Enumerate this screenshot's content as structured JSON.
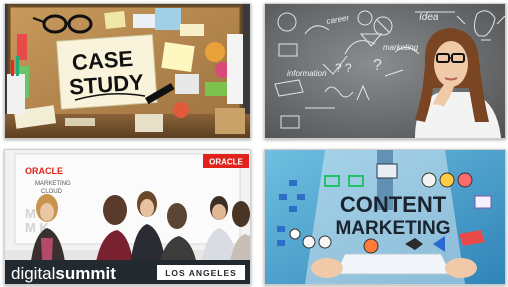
{
  "tiles": [
    {
      "name": "case-study",
      "note_line1": "CASE",
      "note_line2": "STUDY",
      "colors": {
        "cork": "#b88a4f",
        "note": "#f7f1d4",
        "frame": "#7a5a32"
      }
    },
    {
      "name": "thinking-woman",
      "doodle_words": [
        "career",
        "marketing",
        "Idea",
        "information"
      ],
      "colors": {
        "board": "#6c6e70",
        "chalk": "#eceff2"
      }
    },
    {
      "name": "digital-summit-los-angeles",
      "banner_brand": "ORACLE",
      "banner_sub_line1": "MARKETING",
      "banner_sub_line2": "CLOUD",
      "corner_brand": "ORACLE",
      "event_word_light": "digital",
      "event_word_bold": "summit",
      "event_city": "LOS ANGELES",
      "colors": {
        "oracle_red": "#e0231c",
        "bar": "#222a30"
      }
    },
    {
      "name": "content-marketing",
      "headline_line1": "CONTENT",
      "headline_line2": "MARKETING",
      "colors": {
        "bg": "#4fa8cf",
        "tablet": "#f2f6fa"
      }
    }
  ]
}
